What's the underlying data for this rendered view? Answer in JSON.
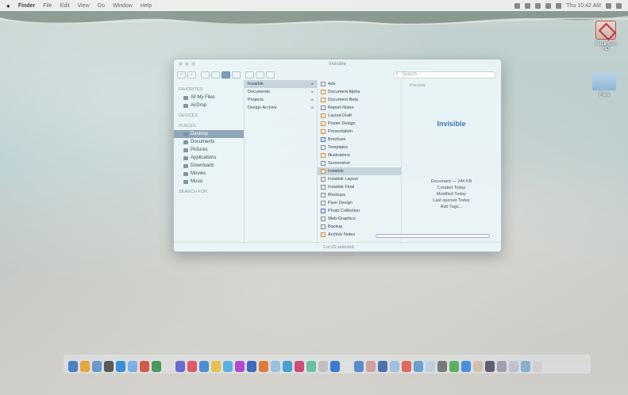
{
  "menubar": {
    "app_name": "Finder",
    "items": [
      "File",
      "Edit",
      "View",
      "Go",
      "Window",
      "Help"
    ],
    "clock": "Thu 10:42 AM"
  },
  "desktop": {
    "hdd_label": "Macintosh HD",
    "folder_label": "Files"
  },
  "finder": {
    "title": "Invisible",
    "search_placeholder": "Search",
    "sidebar": {
      "favorites_header": "FAVORITES",
      "favorites": [
        {
          "label": "All My Files"
        },
        {
          "label": "AirDrop"
        }
      ],
      "devices_header": "DEVICES",
      "places_header": "PLACES",
      "places": [
        {
          "label": "Desktop"
        },
        {
          "label": "Documents"
        },
        {
          "label": "Pictures"
        },
        {
          "label": "Applications"
        },
        {
          "label": "Downloads"
        },
        {
          "label": "Movies"
        },
        {
          "label": "Music"
        }
      ],
      "search_header": "SEARCH FOR"
    },
    "column1": [
      {
        "label": "Invisible"
      },
      {
        "label": "Documents"
      },
      {
        "label": "Projects"
      },
      {
        "label": "Design Archive"
      }
    ],
    "column2": [
      {
        "label": "Ads",
        "icon": "gray"
      },
      {
        "label": "Document Alpha",
        "icon": "orange"
      },
      {
        "label": "Document Beta",
        "icon": "orange"
      },
      {
        "label": "Report Notes",
        "icon": "gray"
      },
      {
        "label": "Layout Draft",
        "icon": "orange"
      },
      {
        "label": "Poster Design",
        "icon": "orange"
      },
      {
        "label": "Presentation",
        "icon": "orange"
      },
      {
        "label": "Brochure",
        "icon": "blue"
      },
      {
        "label": "Templates",
        "icon": "gray"
      },
      {
        "label": "Illustrations",
        "icon": "orange"
      },
      {
        "label": "Screenshot",
        "icon": "gray"
      },
      {
        "label": "Invisible",
        "icon": "orange"
      },
      {
        "label": "Invisible Layout",
        "icon": "gray"
      },
      {
        "label": "Invisible Final",
        "icon": "gray"
      },
      {
        "label": "Mockups",
        "icon": "gray"
      },
      {
        "label": "Flyer Design",
        "icon": "gray"
      },
      {
        "label": "Photo Collection",
        "icon": "blue"
      },
      {
        "label": "Web Graphics",
        "icon": "gray"
      },
      {
        "label": "Backup",
        "icon": "gray"
      },
      {
        "label": "Archive Notes",
        "icon": "orange"
      }
    ],
    "preview": {
      "header": "Preview",
      "title": "Invisible",
      "meta": [
        "Document — 244 KB",
        "Created Today",
        "Modified Today",
        "Last opened Today",
        "Add Tags..."
      ]
    },
    "status": "1 of 20 selected"
  },
  "dock": {
    "colors": [
      "#4a7fc4",
      "#e6a63c",
      "#6b9ad0",
      "#5a5a5a",
      "#3c8fd8",
      "#7bb0e6",
      "#d25a4a",
      "#4a9a5c",
      "#ddd",
      "#6a6ad0",
      "#e05a6a",
      "#4a90d0",
      "#e6c04a",
      "#5ab0e0",
      "#b04ad0",
      "#3c6ac0",
      "#e07a3a",
      "#9ac0e0",
      "#4aa0d0",
      "#d04a7a",
      "#6ac0a0",
      "#c0c0c0",
      "#3a7ad0",
      "#e0e0e0",
      "#5a8ad0",
      "#d0a0a0",
      "#4a70b0",
      "#a0c0e0",
      "#e06a5a",
      "#6aa0d0",
      "#c0d0e0",
      "#7a7a7a",
      "#5ab060",
      "#4a90e0",
      "#d0c0b0",
      "#606070",
      "#a0a0b0",
      "#c0c0d0",
      "#8ab0d0",
      "#d0d0d0"
    ]
  }
}
